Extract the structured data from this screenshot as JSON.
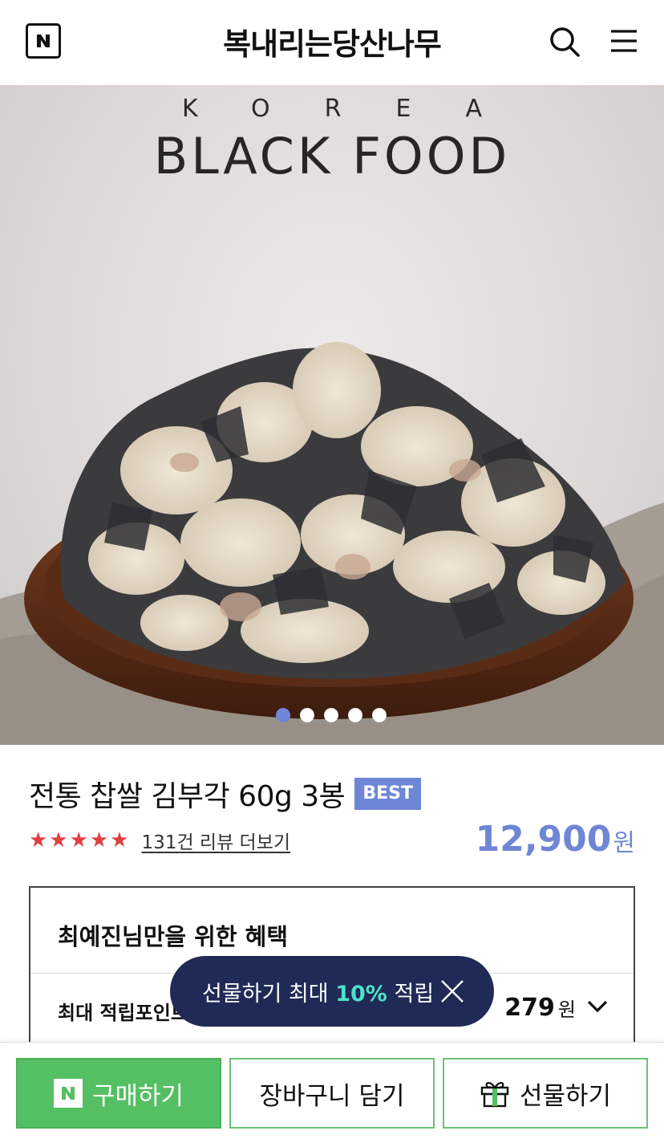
{
  "header": {
    "store_title": "복내리는당산나무",
    "logo_letter": "N"
  },
  "hero": {
    "brand_top": "KOREA",
    "brand_main": "BLACK FOOD",
    "carousel_total": 5,
    "carousel_active": 1
  },
  "product": {
    "name": "전통 찹쌀 김부각 60g 3봉",
    "badge": "BEST",
    "stars": "★★★★★",
    "review_link": "131건 리뷰 더보기",
    "price": "12,900",
    "price_unit": "원"
  },
  "benefit": {
    "title": "최예진님만을 위한 혜택",
    "row_label": "최대 적립포인트",
    "points": "279",
    "points_unit": "원"
  },
  "toast": {
    "text_before": "선물하기 최대 ",
    "highlight": "10%",
    "text_after": " 적립"
  },
  "bottom_bar": {
    "buy_label": "구매하기",
    "cart_label": "장바구니 담기",
    "gift_label": "선물하기"
  },
  "colors": {
    "accent": "#6f86d6",
    "buy_green": "#55bf63",
    "toast_bg": "#1f2a57",
    "toast_highlight": "#4fe0c8",
    "star_red": "#e1403f"
  }
}
